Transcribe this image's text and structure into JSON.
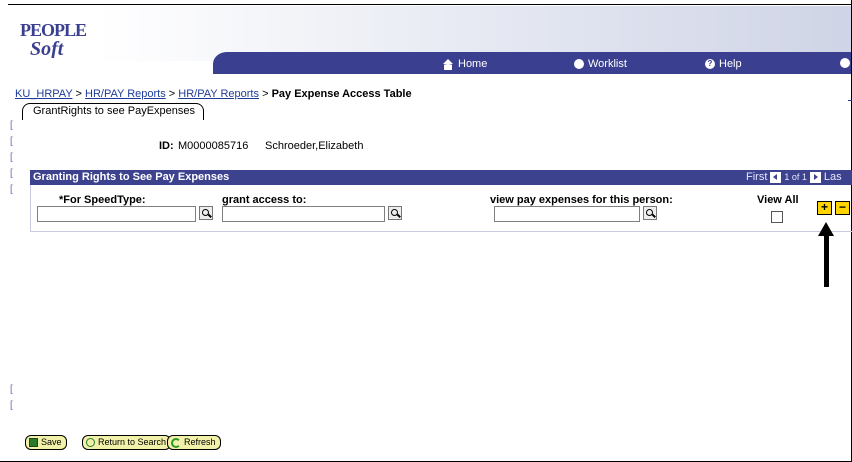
{
  "header": {
    "logo_text": "PEOPLE Soft",
    "nav": [
      {
        "label": "Home",
        "icon": "home-icon"
      },
      {
        "label": "Worklist",
        "icon": "worklist-icon"
      },
      {
        "label": "Help",
        "icon": "help-icon"
      },
      {
        "label": "",
        "icon": "logout-icon"
      }
    ],
    "colors": {
      "nav_bar": "#3a3f8f",
      "grid_header": "#3d428f",
      "button_bg": "#f1f1aa",
      "row_button": "#ffd400"
    }
  },
  "breadcrumb": {
    "items": [
      "KU_HRPAY",
      "HR/PAY Reports",
      "HR/PAY Reports"
    ],
    "separator": ">",
    "current": "Pay Expense Access Table"
  },
  "tab": {
    "label": "GrantRights to see PayExpenses"
  },
  "record": {
    "id_label": "ID:",
    "id_value": "M0000085716",
    "name": "Schroeder,Elizabeth"
  },
  "grid": {
    "title": "Granting Rights to See Pay Expenses",
    "nav": {
      "first": "First",
      "range": "1 of 1",
      "last": "Las"
    },
    "columns": [
      {
        "label": "*For SpeedType:"
      },
      {
        "label": "grant access to:"
      },
      {
        "label": "view pay expenses for this person:"
      },
      {
        "label": "View All"
      }
    ],
    "rows": [
      {
        "speedtype": "",
        "grant_access": "",
        "person": "",
        "view_all": false
      }
    ],
    "add_label": "+",
    "delete_label": "−"
  },
  "footer": {
    "save": "Save",
    "return_to_search": "Return to Search",
    "refresh": "Refresh"
  }
}
